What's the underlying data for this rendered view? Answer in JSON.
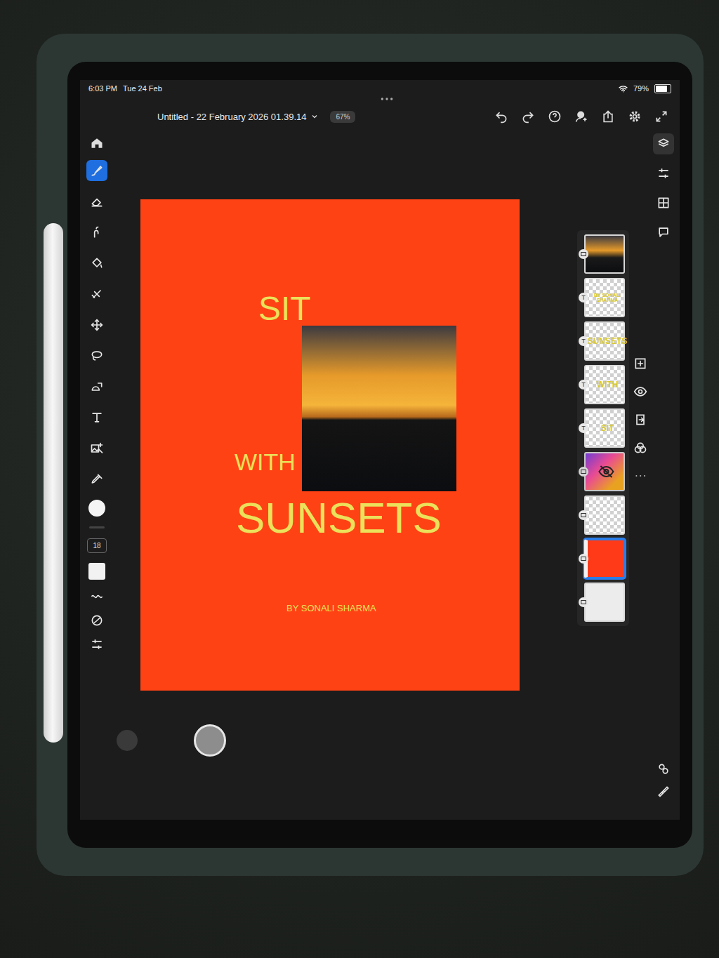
{
  "status_bar": {
    "time": "6:03 PM",
    "date": "Tue 24 Feb",
    "battery": "79%",
    "battery_level": 0.79
  },
  "document": {
    "title": "Untitled - 22 February 2026 01.39.14",
    "zoom": "67%"
  },
  "tools": [
    {
      "selected": true
    },
    {
      "selected": false
    },
    {
      "selected": false
    },
    {
      "selected": false
    },
    {
      "selected": false
    },
    {
      "selected": false
    },
    {
      "selected": false
    },
    {
      "selected": false
    },
    {
      "selected": false
    },
    {
      "selected": false
    },
    {
      "selected": false
    }
  ],
  "foreground_color": "#f4f4f4",
  "brush": {
    "size": "18"
  },
  "poster": {
    "title_top": "SIT",
    "title_middle": "WITH",
    "title_bottom": "SUNSETS",
    "byline": "BY SONALI SHARMA"
  },
  "layers": [
    {
      "kind": "image",
      "text": "",
      "badge": "",
      "visible": true,
      "selected": false
    },
    {
      "kind": "text",
      "text": "BY SONALI SHARMA",
      "badge": "T",
      "visible": true,
      "selected": false
    },
    {
      "kind": "text",
      "text": "SUNSETS",
      "badge": "T",
      "visible": true,
      "selected": false
    },
    {
      "kind": "text",
      "text": "WITH",
      "badge": "T",
      "visible": true,
      "selected": false
    },
    {
      "kind": "text",
      "text": "SIT",
      "badge": "T",
      "visible": true,
      "selected": false
    },
    {
      "kind": "gradient",
      "text": "",
      "badge": "",
      "visible": false,
      "selected": false
    },
    {
      "kind": "pixel",
      "text": "",
      "badge": "",
      "visible": true,
      "selected": false
    },
    {
      "kind": "fill",
      "text": "",
      "badge": "",
      "visible": true,
      "selected": true
    },
    {
      "kind": "background",
      "text": "",
      "badge": "",
      "visible": true,
      "selected": false
    }
  ],
  "rail": [
    {
      "selected": true
    },
    {
      "selected": false
    },
    {
      "selected": false
    },
    {
      "selected": false
    }
  ]
}
